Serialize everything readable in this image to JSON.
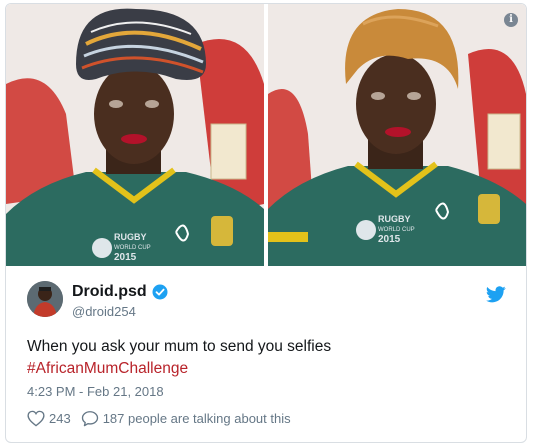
{
  "tweet": {
    "display_name": "Droid.psd",
    "handle": "@droid254",
    "text": "When you ask your mum to send you selfies",
    "hashtag": "#AfricanMumChallenge",
    "timestamp": "4:23 PM - Feb 21, 2018",
    "likes": "243",
    "replies_text": "187 people are talking about this"
  },
  "media": {
    "info_glyph": "i",
    "jersey_text": [
      "RUGBY",
      "WORLD CUP",
      "2015"
    ]
  },
  "colors": {
    "hashtag": "#b8232a",
    "twitter_blue": "#1da1f2",
    "meta_gray": "#657786",
    "jersey_green": "#2c6b60"
  },
  "icons": {
    "verified": "verified-badge-icon",
    "bird": "twitter-bird-icon",
    "like": "heart-icon",
    "reply": "speech-bubble-icon",
    "info": "info-icon"
  }
}
